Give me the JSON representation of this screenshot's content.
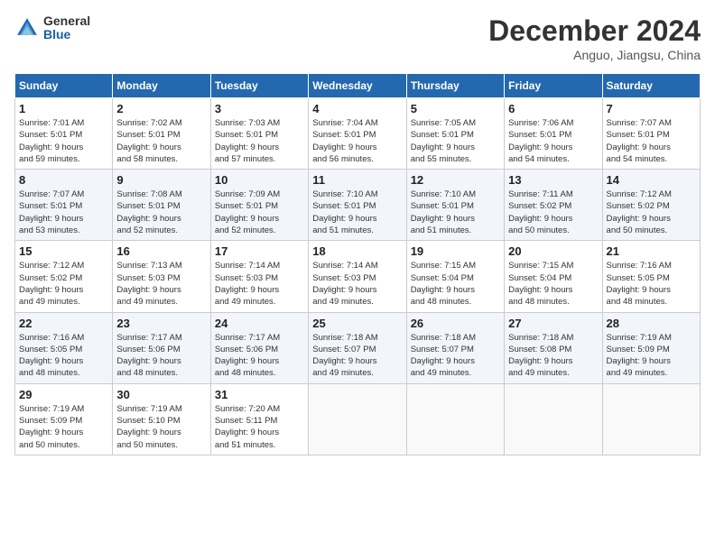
{
  "header": {
    "logo_general": "General",
    "logo_blue": "Blue",
    "month_title": "December 2024",
    "location": "Anguo, Jiangsu, China"
  },
  "weekdays": [
    "Sunday",
    "Monday",
    "Tuesday",
    "Wednesday",
    "Thursday",
    "Friday",
    "Saturday"
  ],
  "weeks": [
    [
      {
        "day": "1",
        "info": "Sunrise: 7:01 AM\nSunset: 5:01 PM\nDaylight: 9 hours\nand 59 minutes."
      },
      {
        "day": "2",
        "info": "Sunrise: 7:02 AM\nSunset: 5:01 PM\nDaylight: 9 hours\nand 58 minutes."
      },
      {
        "day": "3",
        "info": "Sunrise: 7:03 AM\nSunset: 5:01 PM\nDaylight: 9 hours\nand 57 minutes."
      },
      {
        "day": "4",
        "info": "Sunrise: 7:04 AM\nSunset: 5:01 PM\nDaylight: 9 hours\nand 56 minutes."
      },
      {
        "day": "5",
        "info": "Sunrise: 7:05 AM\nSunset: 5:01 PM\nDaylight: 9 hours\nand 55 minutes."
      },
      {
        "day": "6",
        "info": "Sunrise: 7:06 AM\nSunset: 5:01 PM\nDaylight: 9 hours\nand 54 minutes."
      },
      {
        "day": "7",
        "info": "Sunrise: 7:07 AM\nSunset: 5:01 PM\nDaylight: 9 hours\nand 54 minutes."
      }
    ],
    [
      {
        "day": "8",
        "info": "Sunrise: 7:07 AM\nSunset: 5:01 PM\nDaylight: 9 hours\nand 53 minutes."
      },
      {
        "day": "9",
        "info": "Sunrise: 7:08 AM\nSunset: 5:01 PM\nDaylight: 9 hours\nand 52 minutes."
      },
      {
        "day": "10",
        "info": "Sunrise: 7:09 AM\nSunset: 5:01 PM\nDaylight: 9 hours\nand 52 minutes."
      },
      {
        "day": "11",
        "info": "Sunrise: 7:10 AM\nSunset: 5:01 PM\nDaylight: 9 hours\nand 51 minutes."
      },
      {
        "day": "12",
        "info": "Sunrise: 7:10 AM\nSunset: 5:01 PM\nDaylight: 9 hours\nand 51 minutes."
      },
      {
        "day": "13",
        "info": "Sunrise: 7:11 AM\nSunset: 5:02 PM\nDaylight: 9 hours\nand 50 minutes."
      },
      {
        "day": "14",
        "info": "Sunrise: 7:12 AM\nSunset: 5:02 PM\nDaylight: 9 hours\nand 50 minutes."
      }
    ],
    [
      {
        "day": "15",
        "info": "Sunrise: 7:12 AM\nSunset: 5:02 PM\nDaylight: 9 hours\nand 49 minutes."
      },
      {
        "day": "16",
        "info": "Sunrise: 7:13 AM\nSunset: 5:03 PM\nDaylight: 9 hours\nand 49 minutes."
      },
      {
        "day": "17",
        "info": "Sunrise: 7:14 AM\nSunset: 5:03 PM\nDaylight: 9 hours\nand 49 minutes."
      },
      {
        "day": "18",
        "info": "Sunrise: 7:14 AM\nSunset: 5:03 PM\nDaylight: 9 hours\nand 49 minutes."
      },
      {
        "day": "19",
        "info": "Sunrise: 7:15 AM\nSunset: 5:04 PM\nDaylight: 9 hours\nand 48 minutes."
      },
      {
        "day": "20",
        "info": "Sunrise: 7:15 AM\nSunset: 5:04 PM\nDaylight: 9 hours\nand 48 minutes."
      },
      {
        "day": "21",
        "info": "Sunrise: 7:16 AM\nSunset: 5:05 PM\nDaylight: 9 hours\nand 48 minutes."
      }
    ],
    [
      {
        "day": "22",
        "info": "Sunrise: 7:16 AM\nSunset: 5:05 PM\nDaylight: 9 hours\nand 48 minutes."
      },
      {
        "day": "23",
        "info": "Sunrise: 7:17 AM\nSunset: 5:06 PM\nDaylight: 9 hours\nand 48 minutes."
      },
      {
        "day": "24",
        "info": "Sunrise: 7:17 AM\nSunset: 5:06 PM\nDaylight: 9 hours\nand 48 minutes."
      },
      {
        "day": "25",
        "info": "Sunrise: 7:18 AM\nSunset: 5:07 PM\nDaylight: 9 hours\nand 49 minutes."
      },
      {
        "day": "26",
        "info": "Sunrise: 7:18 AM\nSunset: 5:07 PM\nDaylight: 9 hours\nand 49 minutes."
      },
      {
        "day": "27",
        "info": "Sunrise: 7:18 AM\nSunset: 5:08 PM\nDaylight: 9 hours\nand 49 minutes."
      },
      {
        "day": "28",
        "info": "Sunrise: 7:19 AM\nSunset: 5:09 PM\nDaylight: 9 hours\nand 49 minutes."
      }
    ],
    [
      {
        "day": "29",
        "info": "Sunrise: 7:19 AM\nSunset: 5:09 PM\nDaylight: 9 hours\nand 50 minutes."
      },
      {
        "day": "30",
        "info": "Sunrise: 7:19 AM\nSunset: 5:10 PM\nDaylight: 9 hours\nand 50 minutes."
      },
      {
        "day": "31",
        "info": "Sunrise: 7:20 AM\nSunset: 5:11 PM\nDaylight: 9 hours\nand 51 minutes."
      },
      {
        "day": "",
        "info": ""
      },
      {
        "day": "",
        "info": ""
      },
      {
        "day": "",
        "info": ""
      },
      {
        "day": "",
        "info": ""
      }
    ]
  ]
}
